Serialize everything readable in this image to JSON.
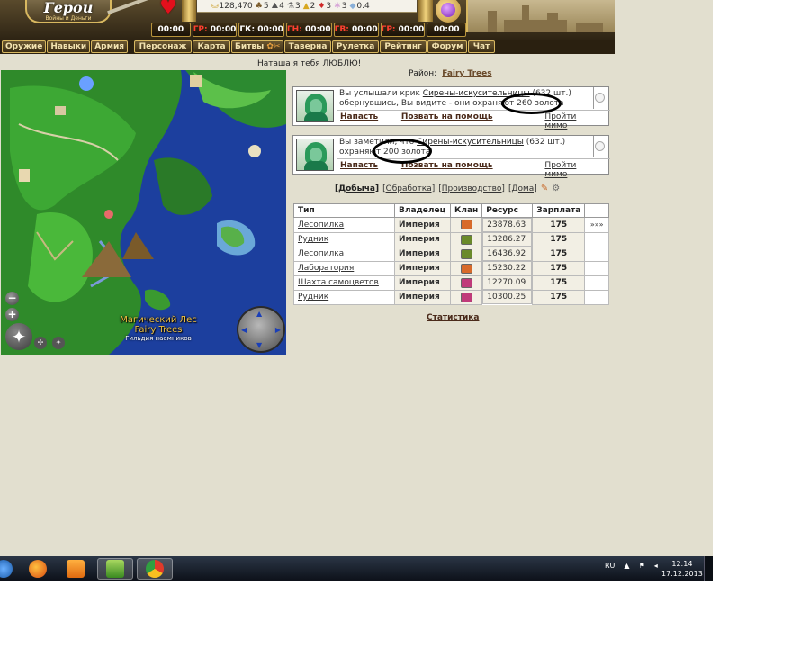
{
  "header": {
    "logo_title": "Герои",
    "logo_sub": "Войны и Деньги",
    "resources": [
      {
        "icon": "gold-icon",
        "glyph": "⛀",
        "value": "128,470"
      },
      {
        "icon": "wood-icon",
        "glyph": "♣",
        "value": "5"
      },
      {
        "icon": "ore-icon",
        "glyph": "⛰",
        "value": "4"
      },
      {
        "icon": "mercury-icon",
        "glyph": "⚗",
        "value": "3"
      },
      {
        "icon": "sulfur-icon",
        "glyph": "▲",
        "value": "2"
      },
      {
        "icon": "crystal-icon",
        "glyph": "♦",
        "value": "3"
      },
      {
        "icon": "gem-icon",
        "glyph": "✱",
        "value": "3"
      },
      {
        "icon": "diamond-icon",
        "glyph": "◆",
        "value": "0.4"
      }
    ],
    "timers": [
      {
        "label": "",
        "value": "00:00"
      },
      {
        "label": "ГР:",
        "value": "00:00"
      },
      {
        "label": "ГК:",
        "value": "00:00"
      },
      {
        "label": "ГН:",
        "value": "00:00"
      },
      {
        "label": "ГВ:",
        "value": "00:00"
      },
      {
        "label": "ГР:",
        "value": "00:00"
      },
      {
        "label": "",
        "value": "00:00"
      }
    ]
  },
  "nav": {
    "items": [
      "Оружие",
      "Навыки",
      "Армия",
      "Персонаж",
      "Карта",
      "Битвы",
      "Таверна",
      "Рулетка",
      "Рейтинг",
      "Форум",
      "Чат"
    ],
    "battles_icon": "✿✂"
  },
  "motto": "Наташа я тебя ЛЮБЛЮ!",
  "map": {
    "caption_line1": "Магический Лес",
    "caption_line2": "Fairy Trees",
    "caption_line3": "Гильдия наемников",
    "zoom_out": "−",
    "zoom_in": "+",
    "compass_glyph": "✦"
  },
  "district": {
    "label": "Район:",
    "name": "Fairy Trees"
  },
  "events": [
    {
      "pre": "Вы услышали крик ",
      "link": "Сирены-искусительницы",
      "mid": " (632 шт.) обернувшись, Вы видите - они охраняют ",
      "highlight": "260 золота",
      "attack": "Напасть",
      "help": "Позвать на помощь",
      "pass": "Пройти мимо"
    },
    {
      "pre": "Вы заметили, что ",
      "link": "Сирены-искусительницы",
      "mid": " (632 шт.) охраняют ",
      "highlight": "200 золота",
      "attack": "Напасть",
      "help": "Позвать на помощь",
      "pass": "Пройти мимо"
    }
  ],
  "tabs": [
    "[Добыча]",
    "[Обработка]",
    "[Производство]",
    "[Дома]"
  ],
  "table": {
    "headers": [
      "Тип",
      "Владелец",
      "Клан",
      "Ресурс",
      "Зарплата",
      ""
    ],
    "rows": [
      {
        "type": "Лесопилка",
        "owner": "Империя",
        "clan_color": "#d86a2a",
        "resource": "23878.63",
        "pay": "175",
        "more": "»»»"
      },
      {
        "type": "Рудник",
        "owner": "Империя",
        "clan_color": "#6a8a2a",
        "resource": "13286.27",
        "pay": "175",
        "more": ""
      },
      {
        "type": "Лесопилка",
        "owner": "Империя",
        "clan_color": "#6a8a2a",
        "resource": "16436.92",
        "pay": "175",
        "more": ""
      },
      {
        "type": "Лаборатория",
        "owner": "Империя",
        "clan_color": "#d86a2a",
        "resource": "15230.22",
        "pay": "175",
        "more": ""
      },
      {
        "type": "Шахта самоцветов",
        "owner": "Империя",
        "clan_color": "#c03a7a",
        "resource": "12270.09",
        "pay": "175",
        "more": ""
      },
      {
        "type": "Рудник",
        "owner": "Империя",
        "clan_color": "#c03a7a",
        "resource": "10300.25",
        "pay": "175",
        "more": ""
      }
    ]
  },
  "stats_link": "Статистика",
  "taskbar": {
    "lang": "RU",
    "time": "12:14",
    "date": "17.12.2013"
  }
}
